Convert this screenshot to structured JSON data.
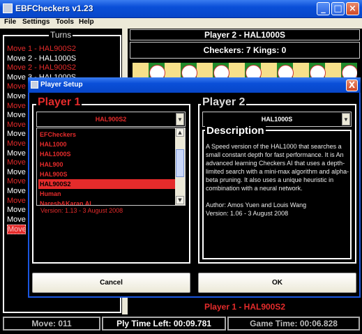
{
  "window": {
    "title": "EBFCheckers v1.23"
  },
  "menu": [
    "File",
    "Settings",
    "Tools",
    "Help"
  ],
  "turns": {
    "title": "Turns",
    "items": [
      {
        "text": "Move 1 - HAL900S2",
        "color": "#e52b2b"
      },
      {
        "text": "Move 2 - HAL1000S",
        "color": "#ffffff"
      },
      {
        "text": "Move 2 - HAL900S2",
        "color": "#e52b2b"
      },
      {
        "text": "Move 3 - HAL1000S",
        "color": "#ffffff"
      },
      {
        "text": "Move",
        "color": "#e52b2b"
      },
      {
        "text": "Move",
        "color": "#ffffff"
      },
      {
        "text": "Move",
        "color": "#e52b2b"
      },
      {
        "text": "Move",
        "color": "#ffffff"
      },
      {
        "text": "Move",
        "color": "#e52b2b"
      },
      {
        "text": "Move",
        "color": "#ffffff"
      },
      {
        "text": "Move",
        "color": "#e52b2b"
      },
      {
        "text": "Move",
        "color": "#ffffff"
      },
      {
        "text": "Move",
        "color": "#e52b2b"
      },
      {
        "text": "Move",
        "color": "#ffffff"
      },
      {
        "text": "Move",
        "color": "#e52b2b"
      },
      {
        "text": "Move",
        "color": "#ffffff"
      },
      {
        "text": "Move",
        "color": "#e52b2b"
      },
      {
        "text": "Move",
        "color": "#ffffff"
      },
      {
        "text": "Move",
        "color": "#ffffff"
      },
      {
        "text": "Move",
        "color": "#e52b2b",
        "selected": true
      }
    ]
  },
  "board": {
    "player2_banner": "Player 2 - HAL1000S",
    "counts": "Checkers: 7   Kings: 0",
    "player1_banner": "Player 1 - HAL900S2"
  },
  "status": {
    "move": "Move: 011",
    "ply_time": "Ply Time Left: 00:09.781",
    "game_time": "Game Time: 00:06.828"
  },
  "dialog": {
    "title": "Player Setup",
    "close": "X",
    "player1": {
      "title": "Player 1",
      "selected": "HAL900S2",
      "options": [
        "EFCheckers",
        "HAL1000",
        "HAL1000S",
        "HAL900",
        "HAL900S",
        "HAL900S2",
        "Human",
        "Naresh&Karan AI"
      ],
      "selected_index": 5,
      "version": "Version: 1.13 - 3 August 2008"
    },
    "player2": {
      "title": "Player 2",
      "selected": "HAL1000S",
      "description_title": "Description",
      "description": "A Speed version of the HAL1000 that searches a small constant depth for fast performance. It is An advanced learning Checkers AI that uses a depth-limited search with a mini-max algorithm and alpha-beta pruning. It also uses a unique heuristic in combination with a neural network.",
      "author": "Author: Amos Yuen and Louis Wang",
      "version": "Version: 1.06 - 3 August 2008"
    },
    "cancel": "Cancel",
    "ok": "OK"
  }
}
